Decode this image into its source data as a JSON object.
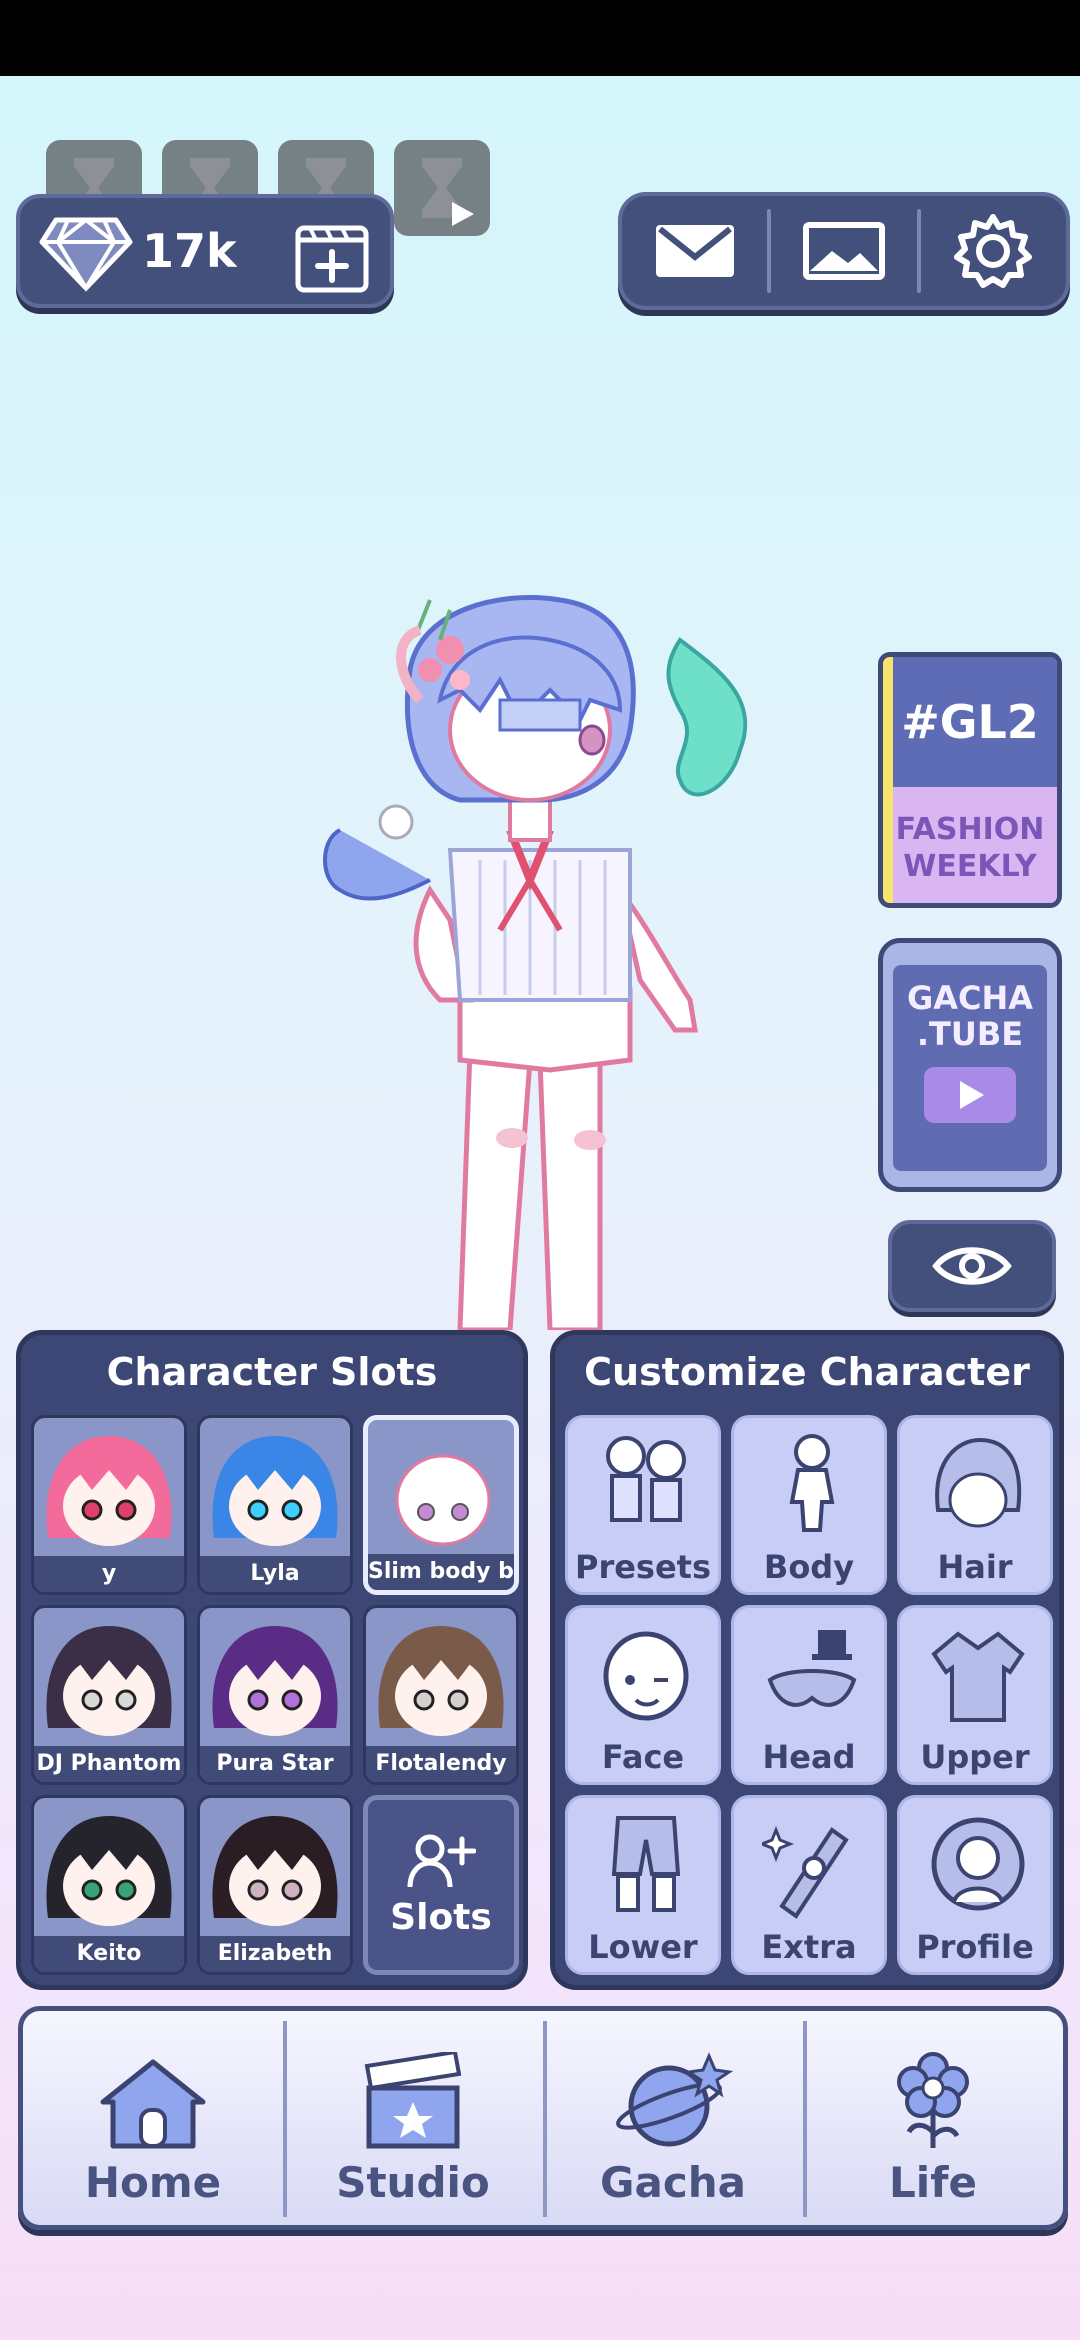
{
  "currency": {
    "gems": "17k"
  },
  "toolbar": {
    "mail_icon": "mail-icon",
    "gallery_icon": "image-icon",
    "settings_icon": "gear-icon"
  },
  "magazine": {
    "title": "#GL2",
    "line1": "FASHION",
    "line2": "WEEKLY"
  },
  "tube": {
    "line1": "GACHA",
    "line2": ".TUBE"
  },
  "character_slots": {
    "title": "Character Slots",
    "slots": [
      {
        "label": "y",
        "hair": "#f36b9b",
        "eyes": "#e0406a"
      },
      {
        "label": "Lyla",
        "hair": "#3a86e6",
        "eyes": "#3bd0ff"
      },
      {
        "label": "Slim body bas",
        "hair": "#ffffff",
        "eyes": "#c58ad6"
      },
      {
        "label": "DJ Phantom",
        "hair": "#3a2f47",
        "eyes": "#d9d9d9"
      },
      {
        "label": "Pura Star",
        "hair": "#5a2c86",
        "eyes": "#b072d8"
      },
      {
        "label": "Flotalendy",
        "hair": "#7a5a48",
        "eyes": "#d6cfd0"
      },
      {
        "label": "Keito",
        "hair": "#25242c",
        "eyes": "#3aa27a"
      },
      {
        "label": "Elizabeth",
        "hair": "#2a1e24",
        "eyes": "#cfb1c2"
      }
    ],
    "add_label": "Slots"
  },
  "customize": {
    "title": "Customize Character",
    "items": [
      {
        "label": "Presets",
        "icon": "presets-icon"
      },
      {
        "label": "Body",
        "icon": "body-icon"
      },
      {
        "label": "Hair",
        "icon": "hair-icon"
      },
      {
        "label": "Face",
        "icon": "face-icon"
      },
      {
        "label": "Head",
        "icon": "head-icon"
      },
      {
        "label": "Upper",
        "icon": "upper-icon"
      },
      {
        "label": "Lower",
        "icon": "lower-icon"
      },
      {
        "label": "Extra",
        "icon": "extra-icon"
      },
      {
        "label": "Profile",
        "icon": "profile-icon"
      }
    ]
  },
  "nav": {
    "items": [
      {
        "label": "Home",
        "icon": "home-icon"
      },
      {
        "label": "Studio",
        "icon": "clapperboard-icon"
      },
      {
        "label": "Gacha",
        "icon": "gacha-planet-icon"
      },
      {
        "label": "Life",
        "icon": "flower-icon"
      }
    ]
  }
}
